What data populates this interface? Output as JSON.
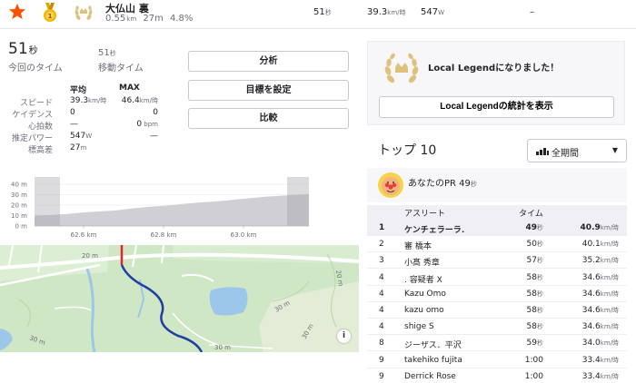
{
  "segment": {
    "name": "大仏山 裏",
    "distance": "0.55",
    "distance_unit": "km",
    "elev_gain": "27m",
    "grade": "4.8%",
    "time": "51",
    "time_unit": "秒",
    "speed": "39.3",
    "speed_unit": "km/時",
    "power": "547",
    "power_unit": "W",
    "hr": "–"
  },
  "stats": {
    "elapsed_value": "51",
    "elapsed_unit": "秒",
    "elapsed_label": "今回のタイム",
    "moving_value": "51",
    "moving_unit": "秒",
    "moving_label": "移動タイム",
    "col_avg": "平均",
    "col_max": "MAX",
    "rows": [
      {
        "label": "スピード",
        "avg": "39.3",
        "avg_unit": "km/時",
        "max": "46.4",
        "max_unit": "km/時"
      },
      {
        "label": "ケイデンス",
        "avg": "0",
        "avg_unit": "",
        "max": "0",
        "max_unit": ""
      },
      {
        "label": "心拍数",
        "avg": "—",
        "avg_unit": "",
        "max": "0",
        "max_unit": " bpm"
      },
      {
        "label": "推定パワー",
        "avg": "547",
        "avg_unit": "W",
        "max": "—",
        "max_unit": ""
      },
      {
        "label": "標高差",
        "avg": "27",
        "avg_unit": "m",
        "max": "",
        "max_unit": ""
      }
    ]
  },
  "buttons": {
    "analyze": "分析",
    "set_goal": "目標を設定",
    "compare": "比較"
  },
  "elevation": {
    "y_ticks": [
      "40 m",
      "30 m",
      "20 m",
      "10 m",
      "0 m"
    ],
    "x_ticks": [
      "62.6 km",
      "62.8 km",
      "63.0 km"
    ],
    "profile": [
      [
        0,
        10
      ],
      [
        6,
        10.5
      ],
      [
        12,
        11.5
      ],
      [
        18,
        13
      ],
      [
        24,
        14
      ],
      [
        30,
        15
      ],
      [
        36,
        17
      ],
      [
        42,
        18.5
      ],
      [
        48,
        19.5
      ],
      [
        54,
        21
      ],
      [
        60,
        22.5
      ],
      [
        66,
        23.5
      ],
      [
        72,
        25
      ],
      [
        78,
        26.5
      ],
      [
        84,
        28
      ],
      [
        90,
        29
      ],
      [
        100,
        30.5
      ]
    ]
  },
  "legend": {
    "title": "Local Legendになりました！",
    "button": "Local Legendの統計を表示"
  },
  "leaderboard": {
    "title": "トップ 10",
    "period": "全期間",
    "pr_label": "あなたのPR",
    "pr_time": "49",
    "pr_unit": "秒",
    "col_athlete": "アスリート",
    "col_time": "タイム",
    "entries": [
      {
        "rank": "1",
        "name": "ケンチェラーラ．",
        "time": "49",
        "time_unit": "秒",
        "speed": "40.9",
        "speed_unit": "km/時"
      },
      {
        "rank": "2",
        "name": "審 橋本",
        "time": "50",
        "time_unit": "秒",
        "speed": "40.1",
        "speed_unit": "km/時"
      },
      {
        "rank": "3",
        "name": "小髙 秀章",
        "time": "57",
        "time_unit": "秒",
        "speed": "35.2",
        "speed_unit": "km/時"
      },
      {
        "rank": "4",
        "name": ". 容疑者 X",
        "time": "58",
        "time_unit": "秒",
        "speed": "34.6",
        "speed_unit": "km/時"
      },
      {
        "rank": "4",
        "name": "Kazu Omo",
        "time": "58",
        "time_unit": "秒",
        "speed": "34.6",
        "speed_unit": "km/時"
      },
      {
        "rank": "4",
        "name": "kazu omo",
        "time": "58",
        "time_unit": "秒",
        "speed": "34.6",
        "speed_unit": "km/時"
      },
      {
        "rank": "4",
        "name": "shige S",
        "time": "58",
        "time_unit": "秒",
        "speed": "34.6",
        "speed_unit": "km/時"
      },
      {
        "rank": "8",
        "name": "ジーザス．平沢",
        "time": "59",
        "time_unit": "秒",
        "speed": "34.0",
        "speed_unit": "km/時"
      },
      {
        "rank": "9",
        "name": "takehiko fujita",
        "time": "1:00",
        "time_unit": "",
        "speed": "33.4",
        "speed_unit": "km/時"
      },
      {
        "rank": "9",
        "name": "Derrick Rose",
        "time": "1:00",
        "time_unit": "",
        "speed": "33.4",
        "speed_unit": "km/時"
      }
    ]
  },
  "map": {
    "contour_labels": [
      "30 m",
      "20 m",
      "30 m",
      "20 m",
      "30 m",
      "30 m"
    ]
  },
  "icons": [
    "star-icon",
    "gold-medal-icon",
    "local-legend-laurel-icon",
    "info-icon",
    "bar-chart-icon",
    "chevron-down-icon"
  ],
  "colors": {
    "accent": "#fc5200",
    "route_red": "#e0262b",
    "route_blue": "#1f3fa5",
    "gold": "#e0c179"
  }
}
